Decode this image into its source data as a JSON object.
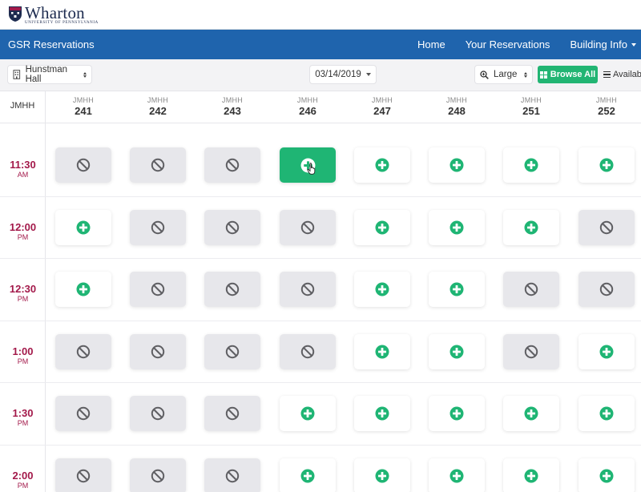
{
  "logo": {
    "word": "Wharton",
    "sub": "University of Pennsylvania"
  },
  "nav": {
    "brand": "GSR Reservations",
    "links": [
      "Home",
      "Your Reservations",
      "Building Info"
    ]
  },
  "toolbar": {
    "building": "Hunstman Hall",
    "date": "03/14/2019",
    "size": "Large",
    "browse_all": "Browse All",
    "available": "Available"
  },
  "grid": {
    "corner": "JMHH",
    "rooms": [
      {
        "building": "JMHH",
        "number": "241"
      },
      {
        "building": "JMHH",
        "number": "242"
      },
      {
        "building": "JMHH",
        "number": "243"
      },
      {
        "building": "JMHH",
        "number": "246"
      },
      {
        "building": "JMHH",
        "number": "247"
      },
      {
        "building": "JMHH",
        "number": "248"
      },
      {
        "building": "JMHH",
        "number": "251"
      },
      {
        "building": "JMHH",
        "number": "252"
      }
    ],
    "times": [
      {
        "time": "11:30",
        "ampm": "AM",
        "slots": [
          "unavailable",
          "unavailable",
          "unavailable",
          "selected",
          "available",
          "available",
          "available",
          "available"
        ]
      },
      {
        "time": "12:00",
        "ampm": "PM",
        "slots": [
          "available",
          "unavailable",
          "unavailable",
          "unavailable",
          "available",
          "available",
          "available",
          "unavailable"
        ]
      },
      {
        "time": "12:30",
        "ampm": "PM",
        "slots": [
          "available",
          "unavailable",
          "unavailable",
          "unavailable",
          "available",
          "available",
          "unavailable",
          "unavailable"
        ]
      },
      {
        "time": "1:00",
        "ampm": "PM",
        "slots": [
          "unavailable",
          "unavailable",
          "unavailable",
          "unavailable",
          "available",
          "available",
          "unavailable",
          "available"
        ]
      },
      {
        "time": "1:30",
        "ampm": "PM",
        "slots": [
          "unavailable",
          "unavailable",
          "unavailable",
          "available",
          "available",
          "available",
          "available",
          "available"
        ]
      },
      {
        "time": "2:00",
        "ampm": "PM",
        "slots": [
          "unavailable",
          "unavailable",
          "unavailable",
          "available",
          "available",
          "available",
          "available",
          "available"
        ]
      }
    ]
  },
  "colors": {
    "brand_blue": "#1f64ad",
    "available_green": "#1fb574",
    "time_crimson": "#a3194a",
    "unavailable_gray": "#e7e7eb"
  }
}
